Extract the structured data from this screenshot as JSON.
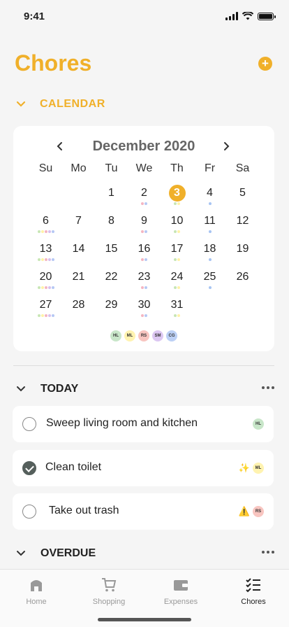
{
  "status": {
    "time": "9:41"
  },
  "header": {
    "title": "Chores",
    "add_label": "+"
  },
  "calendar_section": {
    "label": "CALENDAR",
    "month": "December 2020",
    "weekdays": [
      "Su",
      "Mo",
      "Tu",
      "We",
      "Th",
      "Fr",
      "Sa"
    ],
    "today": 3,
    "first_weekday_index": 2,
    "days_in_month": 31,
    "day_dots": {
      "2": [
        "#f4b6c2",
        "#b6c8f4"
      ],
      "3": [
        "#c8e6b5",
        "#fff2a8"
      ],
      "4": [
        "#a7c4f2"
      ],
      "6": [
        "#c8e6b5",
        "#fff2a8",
        "#f4b6c2",
        "#d6bff0",
        "#b6c8f4"
      ],
      "9": [
        "#f4b6c2",
        "#b6c8f4"
      ],
      "10": [
        "#c8e6b5",
        "#fff2a8"
      ],
      "11": [
        "#a7c4f2"
      ],
      "13": [
        "#c8e6b5",
        "#fff2a8",
        "#f4b6c2",
        "#d6bff0",
        "#b6c8f4"
      ],
      "16": [
        "#f4b6c2",
        "#b6c8f4"
      ],
      "17": [
        "#c8e6b5",
        "#fff2a8"
      ],
      "18": [
        "#a7c4f2"
      ],
      "20": [
        "#c8e6b5",
        "#fff2a8",
        "#f4b6c2",
        "#d6bff0",
        "#b6c8f4"
      ],
      "23": [
        "#f4b6c2",
        "#b6c8f4"
      ],
      "24": [
        "#c8e6b5",
        "#fff2a8"
      ],
      "25": [
        "#a7c4f2"
      ],
      "27": [
        "#c8e6b5",
        "#fff2a8",
        "#f4b6c2",
        "#d6bff0",
        "#b6c8f4"
      ],
      "30": [
        "#f4b6c2",
        "#b6c8f4"
      ],
      "31": [
        "#c8e6b5",
        "#fff2a8"
      ]
    },
    "members": [
      {
        "initials": "HL",
        "color": "#c8e6c9"
      },
      {
        "initials": "ML",
        "color": "#fff3b0"
      },
      {
        "initials": "RS",
        "color": "#f8c5c0"
      },
      {
        "initials": "SM",
        "color": "#dcc7f2"
      },
      {
        "initials": "CG",
        "color": "#bcd0f5"
      }
    ]
  },
  "today_section": {
    "label": "TODAY",
    "tasks": [
      {
        "name": "Sweep living room and kitchen",
        "done": false,
        "emoji": "",
        "assignee": "HL",
        "assignee_color": "#c8e6c9"
      },
      {
        "name": "Clean toilet",
        "done": true,
        "emoji": "✨",
        "assignee": "ML",
        "assignee_color": "#fff3b0"
      },
      {
        "name": "Take out trash",
        "done": false,
        "emoji": "⚠️",
        "assignee": "RS",
        "assignee_color": "#f8c5c0"
      }
    ]
  },
  "overdue_section": {
    "label": "OVERDUE"
  },
  "tabs": [
    {
      "label": "Home",
      "icon": "home-icon",
      "active": false
    },
    {
      "label": "Shopping",
      "icon": "cart-icon",
      "active": false
    },
    {
      "label": "Expenses",
      "icon": "wallet-icon",
      "active": false
    },
    {
      "label": "Chores",
      "icon": "checklist-icon",
      "active": true
    }
  ],
  "colors": {
    "accent": "#f0b02a",
    "text": "#1f1f1f",
    "muted": "#999999"
  }
}
